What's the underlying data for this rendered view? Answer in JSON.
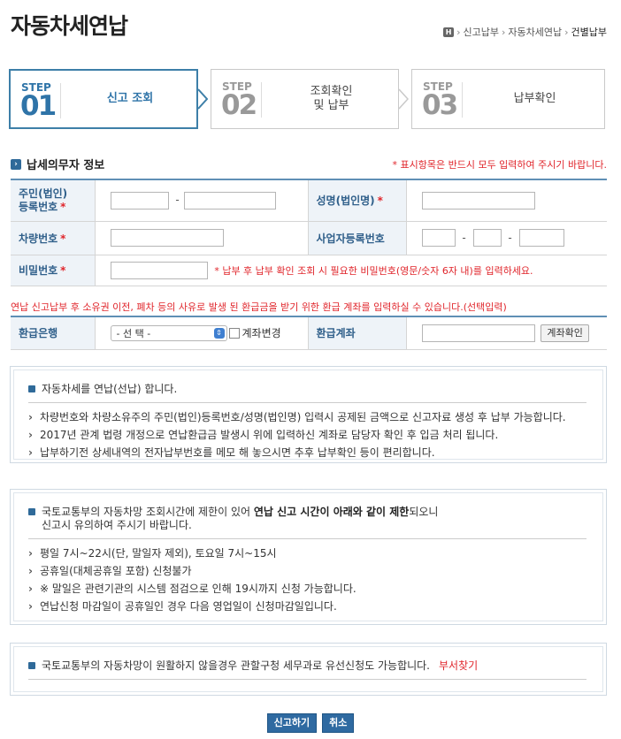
{
  "page": {
    "title": "자동차세연납",
    "breadcrumb": {
      "home": "H",
      "items": [
        "신고납부",
        "자동차세연납",
        "건별납부"
      ]
    }
  },
  "steps": [
    {
      "label": "STEP",
      "num": "01",
      "name": "신고 조회",
      "active": true
    },
    {
      "label": "STEP",
      "num": "02",
      "name": "조회확인\n및 납부",
      "active": false
    },
    {
      "label": "STEP",
      "num": "03",
      "name": "납부확인",
      "active": false
    }
  ],
  "taxpayer": {
    "section_title": "납세의무자 정보",
    "required_note": "* 표시항목은 반드시 모두 입력하여 주시기 바랍니다.",
    "fields": {
      "rrn_label": "주민(법인)\n등록번호",
      "name_label": "성명(법인명)",
      "car_label": "차량번호",
      "bizno_label": "사업자등록번호",
      "pw_label": "비밀번호",
      "pw_note": "* 납부 후 납부 확인 조회 시 필요한 비밀번호(영문/숫자 6자 내)를 입력하세요."
    },
    "star": "*",
    "dash": "-"
  },
  "refund": {
    "note": "연납 신고납부 후 소유권 이전, 폐차 등의 사유로 발생 된 환급금을 받기 위한 환급 계좌를 입력하실 수 있습니다.(선택입력)",
    "bank_label": "환급은행",
    "bank_select": "- 선 택 -",
    "change_label": "계좌변경",
    "account_label": "환급계좌",
    "confirm_button": "계좌확인"
  },
  "info1": {
    "head": "자동차세를 연납(선납) 합니다.",
    "items": [
      "차량번호와 차량소유주의 주민(법인)등록번호/성명(법인명) 입력시 공제된 금액으로 신고자료 생성 후 납부 가능합니다.",
      "2017년 관계 법령 개정으로 연납환급금 발생시 위에 입력하신 계좌로 담당자 확인 후 입금 처리 됩니다.",
      "납부하기전 상세내역의 전자납부번호를 메모 해 놓으시면 추후 납부확인 등이 편리합니다."
    ]
  },
  "info2": {
    "head_a": "국토교통부의 자동차망 조회시간에 제한이 있어 ",
    "head_b": "연납 신고 시간이 아래와 같이 제한",
    "head_c": "되오니",
    "head_d": "신고시 유의하여 주시기 바랍니다.",
    "items": [
      "평일 7시~22시(단, 말일자 제외), 토요일 7시~15시",
      "공휴일(대체공휴일 포함) 신청불가",
      "※ 말일은 관련기관의 시스템 점검으로 인해 19시까지 신청 가능합니다.",
      "연납신청 마감일이 공휴일인 경우 다음 영업일이 신청마감일입니다."
    ]
  },
  "info3": {
    "head": "국토교통부의 자동차망이 원활하지 않을경우 관할구청 세무과로 유선신청도 가능합니다.",
    "link": "부서찾기"
  },
  "actions": {
    "submit": "신고하기",
    "cancel": "취소"
  },
  "colors": {
    "accent": "#2f74a8",
    "required": "#e0252b",
    "button": "#2f6aa1"
  }
}
